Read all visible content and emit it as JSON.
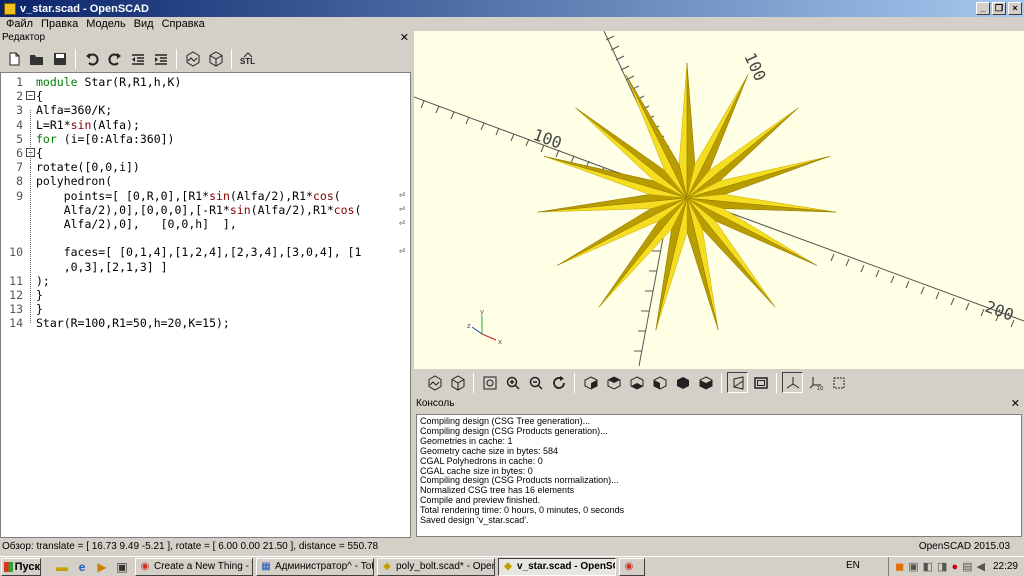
{
  "window": {
    "title": "v_star.scad - OpenSCAD"
  },
  "menu": [
    "Файл",
    "Правка",
    "Модель",
    "Вид",
    "Справка"
  ],
  "editor": {
    "title": "Редактор",
    "lines": [
      {
        "n": "1",
        "fold": "",
        "html": "<span class=\"kw\">module</span> Star(R,R1,h,K)"
      },
      {
        "n": "2",
        "fold": "−",
        "html": "{"
      },
      {
        "n": "3",
        "fold": "",
        "html": "Alfa=360/K;"
      },
      {
        "n": "4",
        "fold": "",
        "html": "L=R1*<span class=\"fn\">sin</span>(Alfa);"
      },
      {
        "n": "5",
        "fold": "",
        "html": "<span class=\"kw\">for</span> (i=[0:Alfa:360])"
      },
      {
        "n": "6",
        "fold": "−",
        "html": "{"
      },
      {
        "n": "7",
        "fold": "",
        "html": "rotate([0,0,i])"
      },
      {
        "n": "8",
        "fold": "",
        "html": "polyhedron("
      },
      {
        "n": "9",
        "fold": "",
        "html": "    points=[ [0,R,0],[R1*<span class=\"fn\">sin</span>(Alfa/2),R1*<span class=\"fn\">cos</span>(",
        "wrap": true
      },
      {
        "n": "",
        "fold": "",
        "html": "    Alfa/2),0],[0,0,0],[-R1*<span class=\"fn\">sin</span>(Alfa/2),R1*<span class=\"fn\">cos</span>(",
        "wrap": true
      },
      {
        "n": "",
        "fold": "",
        "html": "    Alfa/2),0],   [0,0,h]  ],",
        "wrap": true
      },
      {
        "n": "",
        "fold": "",
        "html": ""
      },
      {
        "n": "10",
        "fold": "",
        "html": "    faces=[ [0,1,4],[1,2,4],[2,3,4],[3,0,4], [1",
        "wrap": true
      },
      {
        "n": "",
        "fold": "",
        "html": "    ,0,3],[2,1,3] ]"
      },
      {
        "n": "11",
        "fold": "",
        "html": ");"
      },
      {
        "n": "12",
        "fold": "",
        "html": "}"
      },
      {
        "n": "13",
        "fold": "",
        "html": "}"
      },
      {
        "n": "14",
        "fold": "",
        "html": "Star(R=100,R1=50,h=20,K=15);"
      }
    ]
  },
  "viewport": {
    "axis_labels": [
      "100",
      "100",
      "200"
    ],
    "axis_colors": {
      "x": "#cc2222",
      "y": "#22aa22",
      "z": "#2244cc"
    },
    "star_color": "#f0d000"
  },
  "console": {
    "title": "Консоль",
    "lines": [
      "Compiling design (CSG Tree generation)...",
      "Compiling design (CSG Products generation)...",
      "Geometries in cache: 1",
      "Geometry cache size in bytes: 584",
      "CGAL Polyhedrons in cache: 0",
      "CGAL cache size in bytes: 0",
      "Compiling design (CSG Products normalization)...",
      "Normalized CSG tree has 16 elements",
      "Compile and preview finished.",
      "Total rendering time: 0 hours, 0 minutes, 0 seconds",
      "Saved design 'v_star.scad'."
    ]
  },
  "status": {
    "text": "Обзор: translate = [ 16.73 9.49 -5.21 ], rotate = [ 6.00 0.00 21.50 ], distance = 550.78",
    "version": "OpenSCAD 2015.03"
  },
  "taskbar": {
    "start": "Пуск",
    "tasks": [
      {
        "label": "Create a New Thing - Thi...",
        "icon": "browser-icon",
        "active": false
      },
      {
        "label": "Администратор^ - Tota...",
        "icon": "folder-icon",
        "active": false
      },
      {
        "label": "poly_bolt.scad* - OpenS...",
        "icon": "openscad-icon",
        "active": false
      },
      {
        "label": "v_star.scad - OpenSCAD",
        "icon": "openscad-icon",
        "active": true
      }
    ],
    "lang": "EN",
    "time": "22:29"
  }
}
